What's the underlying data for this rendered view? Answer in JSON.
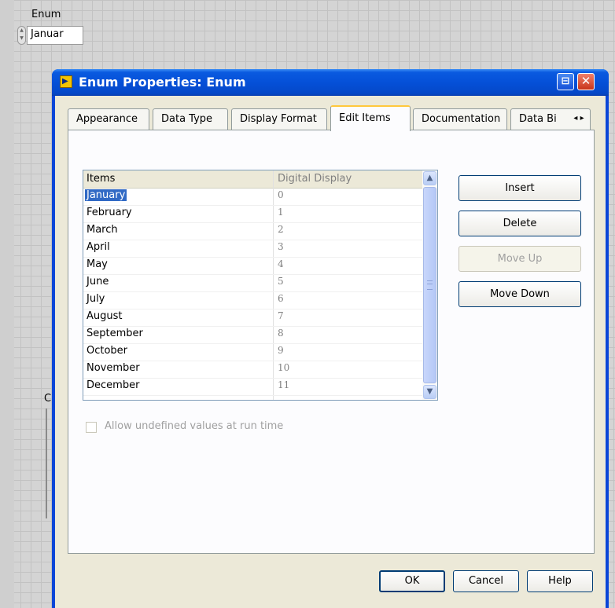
{
  "front_panel": {
    "enum_label": "Enum",
    "enum_value": "Januar",
    "partial_control_glyph": "C"
  },
  "dialog": {
    "title": "Enum Properties: Enum",
    "title_icon_name": "labview-vi-icon",
    "restore_glyph": "⊟",
    "close_glyph": "✕"
  },
  "tabs": [
    {
      "label": "Appearance",
      "active": false
    },
    {
      "label": "Data Type",
      "active": false
    },
    {
      "label": "Display Format",
      "active": false
    },
    {
      "label": "Edit Items",
      "active": true
    },
    {
      "label": "Documentation",
      "active": false
    },
    {
      "label": "Data Bi",
      "active": false
    }
  ],
  "tab_scroll_glyph": "◂ ▸",
  "items_table": {
    "headers": [
      "Items",
      "Digital Display"
    ],
    "rows": [
      {
        "name": "January",
        "value": "0",
        "selected": true
      },
      {
        "name": "February",
        "value": "1"
      },
      {
        "name": "March",
        "value": "2"
      },
      {
        "name": "April",
        "value": "3"
      },
      {
        "name": "May",
        "value": "4"
      },
      {
        "name": "June",
        "value": "5"
      },
      {
        "name": "July",
        "value": "6"
      },
      {
        "name": "August",
        "value": "7"
      },
      {
        "name": "September",
        "value": "8"
      },
      {
        "name": "October",
        "value": "9"
      },
      {
        "name": "November",
        "value": "10"
      },
      {
        "name": "December",
        "value": "11"
      }
    ]
  },
  "side_buttons": {
    "insert": "Insert",
    "delete": "Delete",
    "move_up": "Move Up",
    "move_down": "Move Down"
  },
  "allow_undefined": {
    "label": "Allow undefined values at run time",
    "checked": false,
    "enabled": false
  },
  "bottom_buttons": {
    "ok": "OK",
    "cancel": "Cancel",
    "help": "Help"
  },
  "colors": {
    "title_bar": "#0550d8",
    "selection": "#316ac5",
    "active_tab_accent": "#ffc83c",
    "close_button": "#c8341a"
  }
}
